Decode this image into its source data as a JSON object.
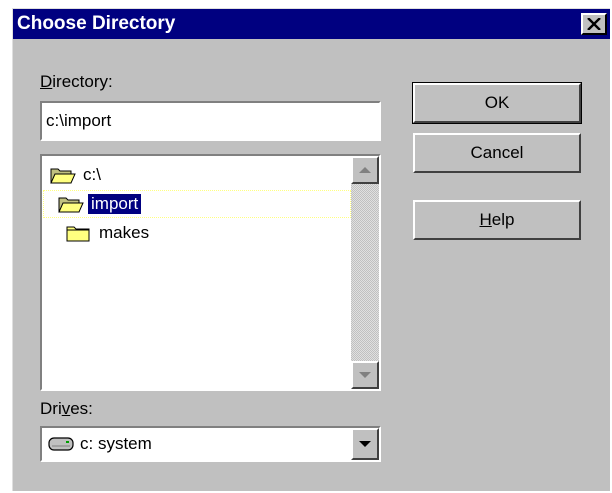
{
  "window": {
    "title": "Choose Directory"
  },
  "directory": {
    "label_mnemonic": "D",
    "label_rest": "irectory:",
    "value": "c:\\import"
  },
  "folders": [
    {
      "label": "c:\\",
      "icon": "open-folder-icon",
      "selected": false
    },
    {
      "label": "import",
      "icon": "open-folder-icon",
      "selected": true
    },
    {
      "label": "makes",
      "icon": "folder-icon",
      "selected": false
    }
  ],
  "drives": {
    "label_pre": "Dri",
    "label_mnemonic": "v",
    "label_rest": "es:",
    "selected": "c: system",
    "icon": "hard-drive-icon"
  },
  "buttons": {
    "ok": "OK",
    "cancel": "Cancel",
    "help_mnemonic": "H",
    "help_rest": "elp"
  },
  "colors": {
    "titlebar": "#000080",
    "face": "#c0c0c0",
    "selection": "#000080",
    "folder": "#ffff80"
  }
}
